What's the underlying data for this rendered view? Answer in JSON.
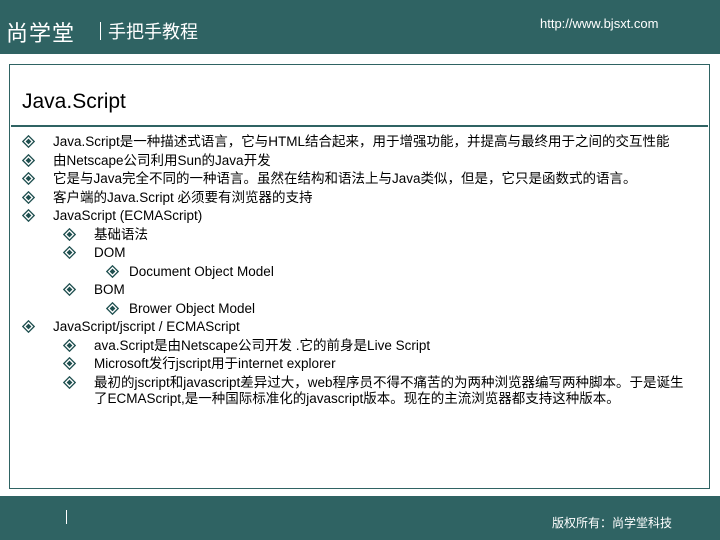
{
  "header": {
    "logo_text": "尚学堂",
    "subtitle": "手把手教程",
    "url": "http://www.bjsxt.com"
  },
  "slide": {
    "title": "Java.Script",
    "bullet_icon": "diamond-bullet-icon",
    "items": [
      {
        "level": 1,
        "text": "Java.Script是一种描述式语言，它与HTML结合起来，用于增强功能，并提高与最终用于之间的交互性能"
      },
      {
        "level": 1,
        "text": "由Netscape公司利用Sun的Java开发"
      },
      {
        "level": 1,
        "text": "它是与Java完全不同的一种语言。虽然在结构和语法上与Java类似，但是，它只是函数式的语言。"
      },
      {
        "level": 1,
        "text": "客户端的Java.Script 必须要有浏览器的支持"
      },
      {
        "level": 1,
        "text": "JavaScript (ECMAScript)"
      },
      {
        "level": 2,
        "text": "基础语法"
      },
      {
        "level": 2,
        "text": "DOM"
      },
      {
        "level": 3,
        "text": "Document Object Model"
      },
      {
        "level": 2,
        "text": "BOM"
      },
      {
        "level": 3,
        "text": "Brower Object Model"
      },
      {
        "level": 1,
        "text": "JavaScript/jscript / ECMAScript"
      },
      {
        "level": 2,
        "text": "ava.Script是由Netscape公司开发 .它的前身是Live Script"
      },
      {
        "level": 2,
        "text": "Microsoft发行jscript用于internet explorer"
      },
      {
        "level": 2,
        "text": "最初的jscript和javascript差异过大，web程序员不得不痛苦的为两种浏览器编写两种脚本。于是诞生了ECMAScript,是一种国际标准化的javascript版本。现在的主流浏览器都支持这种版本。"
      }
    ]
  },
  "footer": {
    "copyright": "版权所有：尚学堂科技"
  },
  "colors": {
    "header_bg": "#2f6363",
    "bullet": "#1f4f4f"
  }
}
